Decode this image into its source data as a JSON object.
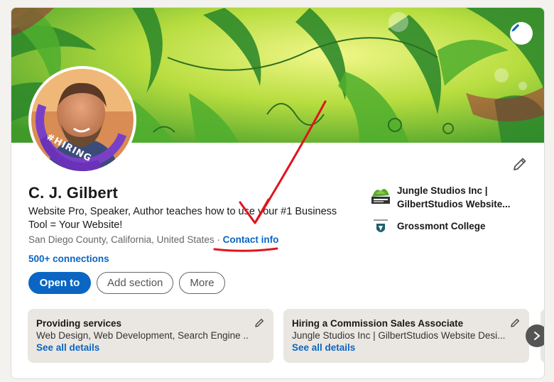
{
  "profile": {
    "name": "C. J. Gilbert",
    "headline": "Website Pro, Speaker, Author teaches how to use your #1 Business Tool = Your Website!",
    "location": "San Diego County, California, United States",
    "separator": " · ",
    "contact_info_label": "Contact info",
    "connections_label": "500+ connections",
    "avatar_badge": "#HIRING"
  },
  "actions": {
    "open_to_label": "Open to",
    "add_section_label": "Add section",
    "more_label": "More"
  },
  "experience": [
    {
      "line1": "Jungle Studios Inc |",
      "line2": "GilbertStudios Website...",
      "logo_icon": "jungle-studios-logo"
    },
    {
      "line1": "Grossmont College",
      "logo_icon": "grossmont-college-logo"
    }
  ],
  "service_cards": [
    {
      "title": "Providing services",
      "subtitle": "Web Design, Web Development, Search Engine ...",
      "link": "See all details"
    },
    {
      "title": "Hiring a Commission Sales Associate",
      "subtitle": "Jungle Studios Inc | GilbertStudios Website Desi...",
      "link": "See all details"
    }
  ],
  "icons": {
    "edit": "pencil-icon",
    "next": "chevron-right-icon"
  },
  "colors": {
    "brand_blue": "#0a66c2",
    "hiring_purple": "#7a3fc7",
    "annotation_red": "#e0141e",
    "card_bg": "#eae7e2"
  }
}
